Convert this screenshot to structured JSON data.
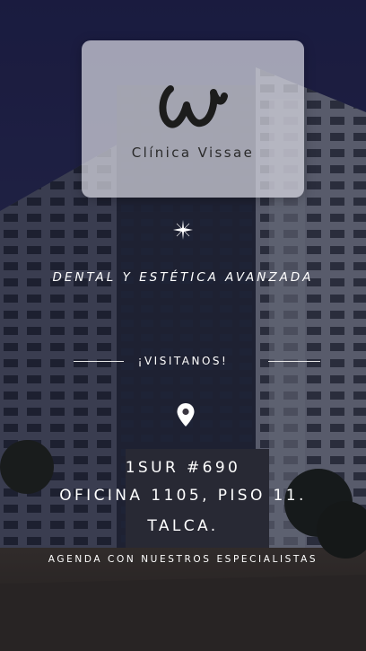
{
  "brand": {
    "name": "Clínica Vissae",
    "logo_letter": "W",
    "logo_icon": "signature-w-logo"
  },
  "tagline": "DENTAL Y ESTÉTICA AVANZADA",
  "visit": "¡VISITANOS!",
  "address": {
    "icon": "location-pin-icon",
    "line1": "1SUR #690",
    "line2": "OFICINA 1105, PISO 11.",
    "line3": "TALCA."
  },
  "cta": "AGENDA CON NUESTROS ESPECIALISTAS",
  "colors": {
    "sky": "#27285a",
    "card": "#d7d7e1",
    "text": "#ffffff",
    "ink": "#1c1c1c"
  }
}
